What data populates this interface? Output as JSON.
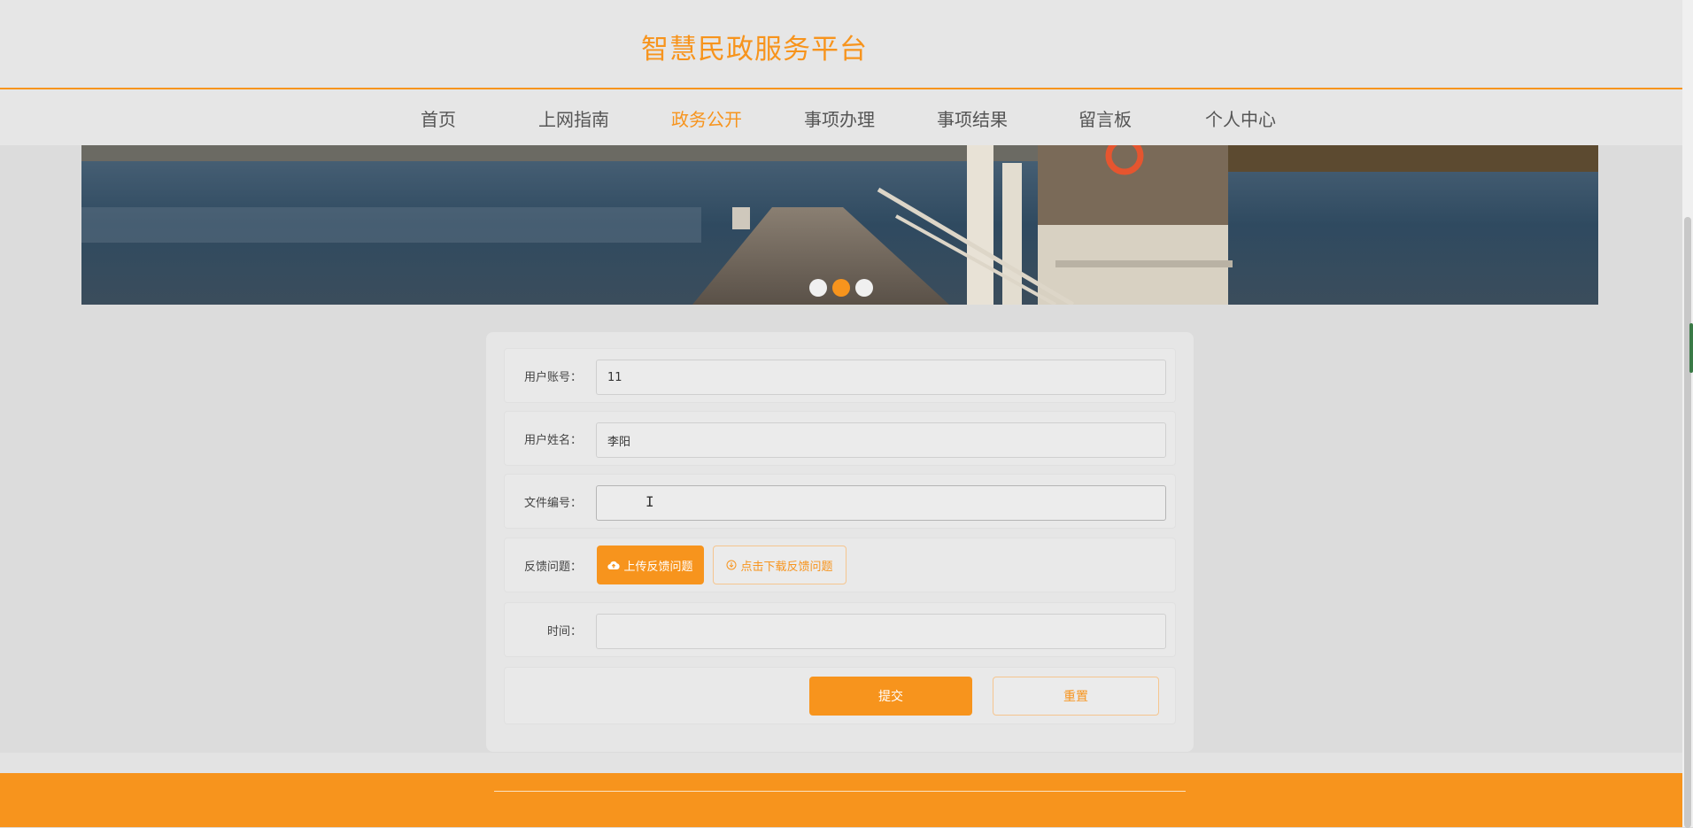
{
  "header": {
    "title": "智慧民政服务平台"
  },
  "nav": {
    "items": [
      {
        "label": "首页"
      },
      {
        "label": "上网指南"
      },
      {
        "label": "政务公开"
      },
      {
        "label": "事项办理"
      },
      {
        "label": "事项结果"
      },
      {
        "label": "留言板"
      },
      {
        "label": "个人中心"
      }
    ],
    "active_index": 2
  },
  "carousel": {
    "slide_count": 3,
    "active_index": 1
  },
  "form": {
    "account": {
      "label": "用户账号：",
      "value": "11"
    },
    "name": {
      "label": "用户姓名：",
      "value": "李阳"
    },
    "file_number": {
      "label": "文件编号：",
      "value": ""
    },
    "feedback": {
      "label": "反馈问题：",
      "upload_label": "上传反馈问题",
      "download_label": "点击下载反馈问题"
    },
    "time": {
      "label": "时间：",
      "value": ""
    },
    "submit_label": "提交",
    "reset_label": "重置"
  },
  "colors": {
    "accent": "#f7941d",
    "background": "#dcdcdc"
  },
  "icons": {
    "upload": "cloud-upload-icon",
    "download": "download-circle-icon"
  }
}
